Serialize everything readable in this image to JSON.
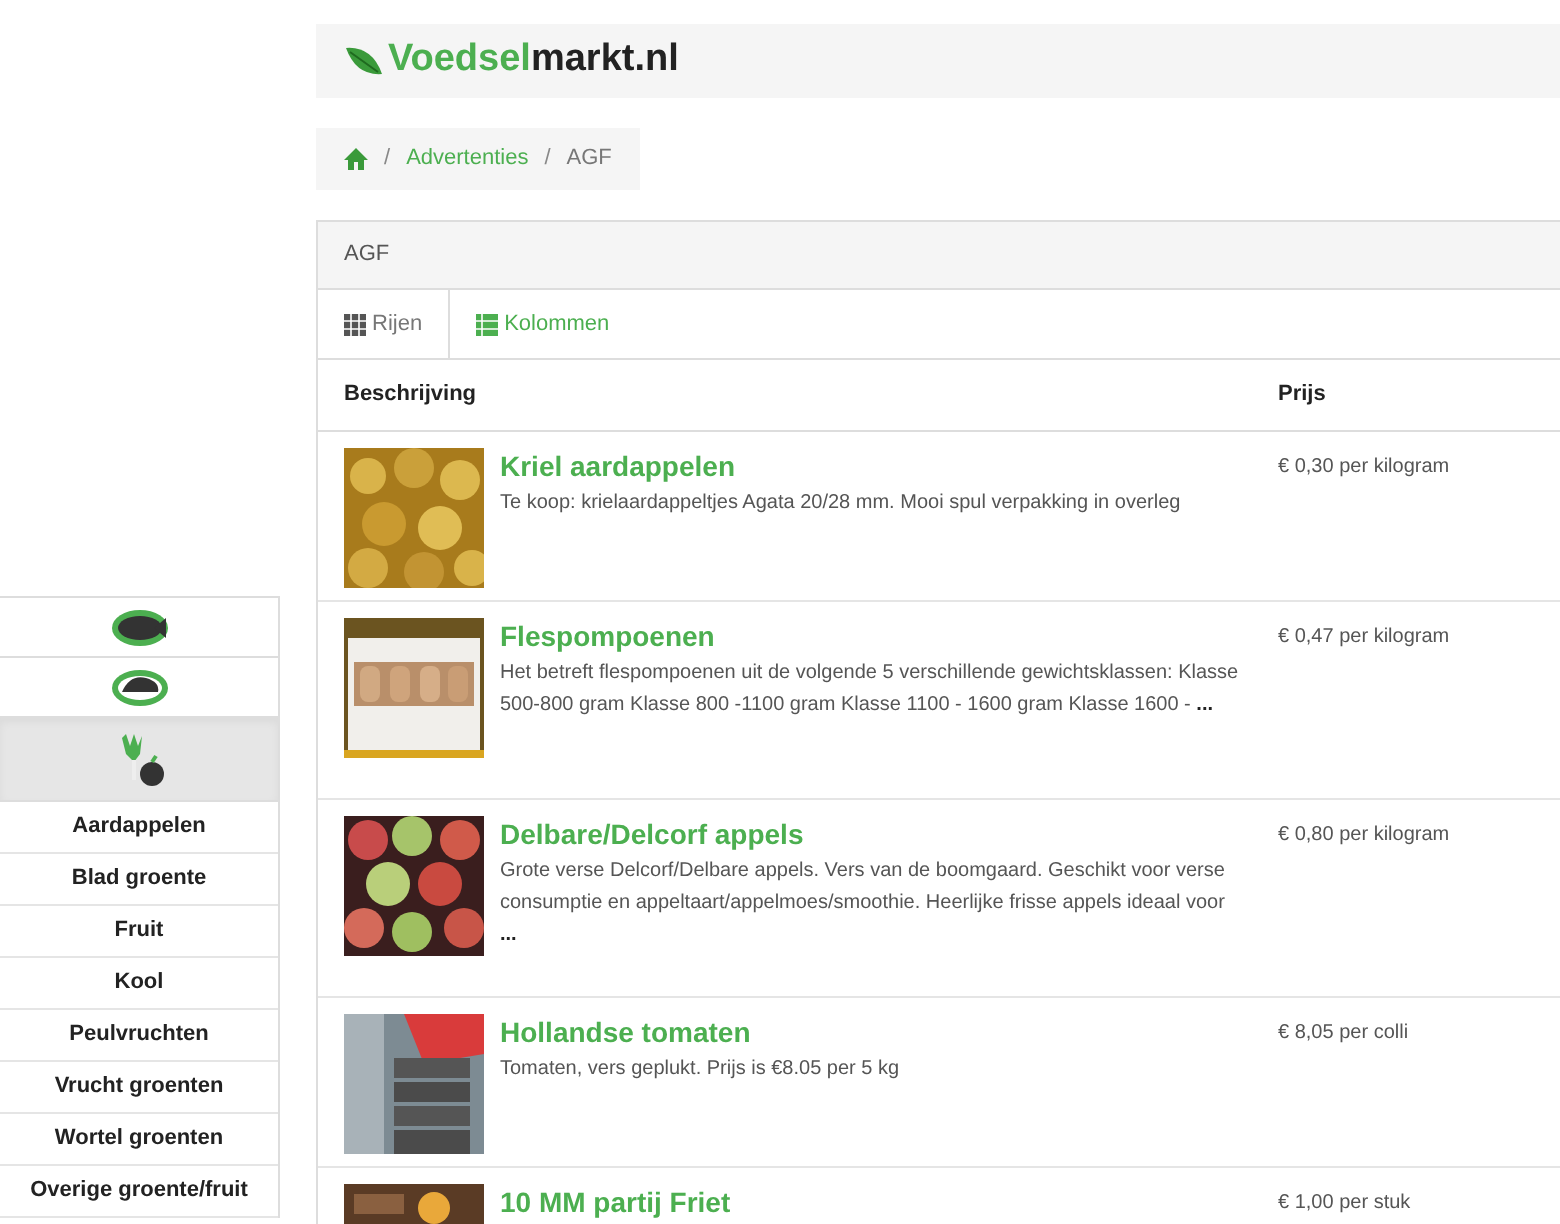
{
  "logo": {
    "brand": "Voedsel",
    "suffix": "markt.nl"
  },
  "breadcrumb": {
    "items": [
      {
        "separator": "/",
        "label": "Advertenties"
      },
      {
        "separator": "/",
        "label": "AGF"
      }
    ]
  },
  "panel": {
    "title": "AGF"
  },
  "tabs": [
    {
      "label": "Rijen",
      "kind": "rows",
      "selected": true
    },
    {
      "label": "Kolommen",
      "kind": "columns",
      "selected": false
    }
  ],
  "table": {
    "columns": [
      "Beschrijving",
      "Prijs"
    ],
    "rows": [
      {
        "title": "Kriel aardappelen",
        "description": "Te koop: krielaardappeltjes Agata 20/28 mm. Mooi spul verpakking in overleg",
        "price": "€ 0,30 per kilogram",
        "kind": "picture"
      },
      {
        "title": "Flespompoenen",
        "description": "Het betreft flespompoenen uit de volgende 5 verschillende gewichtsklassen: Klasse 500-800 gram Klasse 800 -1100 gram Klasse 1100 - 1600 gram Klasse 1600 -",
        "more": "...",
        "price": "€ 0,47 per kilogram",
        "kind": "picture"
      },
      {
        "title": "Delbare/Delcorf appels",
        "description": "Grote verse Delcorf/Delbare appels. Vers van de boomgaard. Geschikt voor verse consumptie en appeltaart/appelmoes/smoothie. Heerlijke frisse appels ideaal voor",
        "more": "...",
        "price": "€ 0,80 per kilogram",
        "kind": "picture"
      },
      {
        "title": "Hollandse tomaten",
        "description": "Tomaten, vers geplukt. Prijs is €8.05 per 5 kg",
        "price": "€ 8,05 per colli",
        "kind": "picture"
      },
      {
        "title": "10 MM partij Friet",
        "price": "€ 1,00 per stuk",
        "kind": "picture"
      }
    ]
  },
  "sidebar": {
    "categories": [
      {
        "kind": "fish",
        "selected": false
      },
      {
        "kind": "meat",
        "selected": false
      },
      {
        "kind": "produce",
        "selected": true
      }
    ],
    "subcategories": [
      "Aardappelen",
      "Blad groente",
      "Fruit",
      "Kool",
      "Peulvruchten",
      "Vrucht groenten",
      "Wortel groenten",
      "Overige groente/fruit"
    ]
  }
}
